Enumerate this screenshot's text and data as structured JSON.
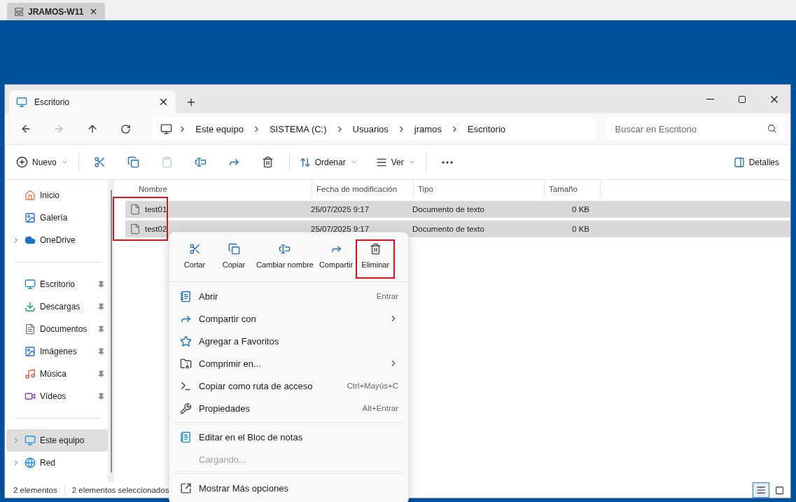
{
  "browser_tab": {
    "title": "JRAMOS-W11"
  },
  "window": {
    "tabs": [
      {
        "label": "Escritorio",
        "selected": true
      }
    ],
    "breadcrumb": [
      "Este equipo",
      "SISTEMA (C:)",
      "Usuarios",
      "jramos",
      "Escritorio"
    ],
    "search": {
      "placeholder": "Buscar en Escritorio"
    }
  },
  "toolbar": {
    "new_label": "Nuevo",
    "sort_label": "Ordenar",
    "view_label": "Ver",
    "details_label": "Detalles"
  },
  "sidebar": {
    "groups": [
      [
        {
          "label": "Inicio",
          "pinned": false,
          "expandable": false,
          "selected": false
        },
        {
          "label": "Galería",
          "pinned": false,
          "expandable": false,
          "selected": false
        },
        {
          "label": "OneDrive",
          "pinned": false,
          "expandable": true,
          "selected": false
        }
      ],
      [
        {
          "label": "Escritorio",
          "pinned": true,
          "expandable": false,
          "selected": false
        },
        {
          "label": "Descargas",
          "pinned": true,
          "expandable": false,
          "selected": false
        },
        {
          "label": "Documentos",
          "pinned": true,
          "expandable": false,
          "selected": false
        },
        {
          "label": "Imágenes",
          "pinned": true,
          "expandable": false,
          "selected": false
        },
        {
          "label": "Música",
          "pinned": true,
          "expandable": false,
          "selected": false
        },
        {
          "label": "Vídeos",
          "pinned": true,
          "expandable": false,
          "selected": false
        }
      ],
      [
        {
          "label": "Este equipo",
          "pinned": false,
          "expandable": true,
          "selected": true
        },
        {
          "label": "Red",
          "pinned": false,
          "expandable": true,
          "selected": false
        }
      ]
    ]
  },
  "table": {
    "columns": [
      "Nombre",
      "Fecha de modificación",
      "Tipo",
      "Tamaño"
    ],
    "names_highlighted": true,
    "rows": [
      {
        "name": "test01",
        "date": "25/07/2025 9:17",
        "type": "Documento de texto",
        "size": "0 KB",
        "selected": true
      },
      {
        "name": "test02",
        "date": "25/07/2025 9:17",
        "type": "Documento de texto",
        "size": "0 KB",
        "selected": true
      }
    ]
  },
  "context_menu": {
    "quick_actions": [
      {
        "label": "Cortar",
        "highlighted": false
      },
      {
        "label": "Copiar",
        "highlighted": false
      },
      {
        "label": "Cambiar nombre",
        "highlighted": false
      },
      {
        "label": "Compartir",
        "highlighted": false
      },
      {
        "label": "Eliminar",
        "highlighted": true
      }
    ],
    "sections": [
      [
        {
          "label": "Abrir",
          "shortcut": "Entrar",
          "submenu": false,
          "disabled": false
        },
        {
          "label": "Compartir con",
          "submenu": true,
          "disabled": false
        },
        {
          "label": "Agregar a Favoritos",
          "submenu": false,
          "disabled": false
        },
        {
          "label": "Comprimir en...",
          "submenu": true,
          "disabled": false
        },
        {
          "label": "Copiar como ruta de acceso",
          "shortcut": "Ctrl+Mayús+C",
          "submenu": false,
          "disabled": false
        },
        {
          "label": "Propiedades",
          "shortcut": "Alt+Entrar",
          "submenu": false,
          "disabled": false
        }
      ],
      [
        {
          "label": "Editar en el Bloc de notas",
          "submenu": false,
          "disabled": false
        },
        {
          "label": "Cargando...",
          "submenu": false,
          "disabled": true
        }
      ],
      [
        {
          "label": "Mostrar Más opciones",
          "submenu": false,
          "disabled": false
        }
      ]
    ]
  },
  "status_bar": [
    "2 elementos",
    "2 elementos seleccionados"
  ],
  "view_modes": [
    {
      "selected": true
    },
    {
      "selected": false
    }
  ]
}
